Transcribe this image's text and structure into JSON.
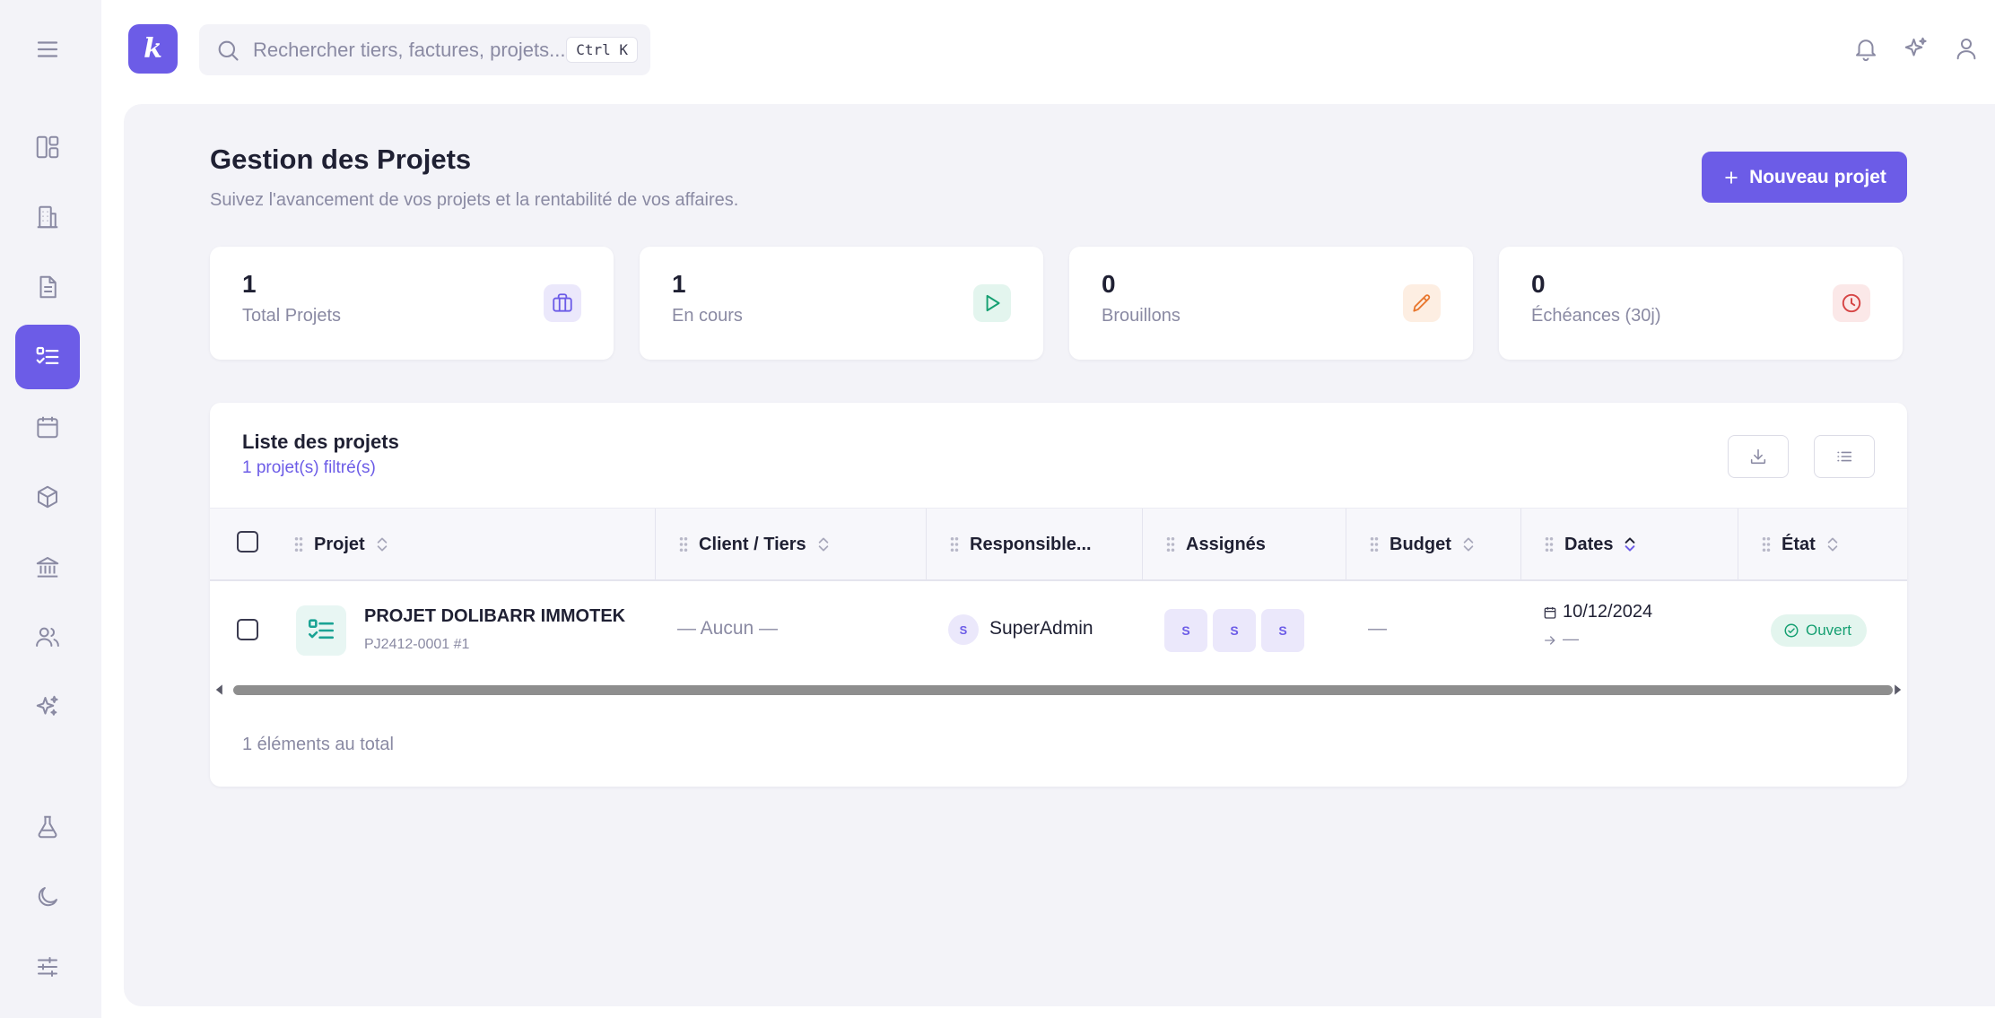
{
  "app": {
    "logo_letter": "k",
    "accent": "#6c5ce7"
  },
  "search": {
    "placeholder": "Rechercher tiers, factures, projets...",
    "shortcut": "Ctrl K"
  },
  "sidebar": {
    "items": [
      {
        "icon": "dashboard-icon",
        "active": false
      },
      {
        "icon": "building-icon",
        "active": false
      },
      {
        "icon": "document-icon",
        "active": false
      },
      {
        "icon": "checklist-icon",
        "active": true
      },
      {
        "icon": "calendar-icon",
        "active": false
      },
      {
        "icon": "box-icon",
        "active": false
      },
      {
        "icon": "bank-icon",
        "active": false
      },
      {
        "icon": "users-icon",
        "active": false
      },
      {
        "icon": "sparkles-icon",
        "active": false
      },
      {
        "icon": "flask-icon",
        "active": false
      },
      {
        "icon": "moon-icon",
        "active": false
      },
      {
        "icon": "sliders-icon",
        "active": false
      }
    ]
  },
  "topbar": {
    "icons": [
      "bell-icon",
      "sparkles-icon",
      "user-icon"
    ]
  },
  "page": {
    "title": "Gestion des Projets",
    "subtitle": "Suivez l'avancement de vos projets et la rentabilité de vos affaires.",
    "new_button": "Nouveau projet"
  },
  "stats": [
    {
      "value": "1",
      "label": "Total Projets",
      "icon": "briefcase-icon",
      "color": "#6c5ce7",
      "bg": "#ebe8fb"
    },
    {
      "value": "1",
      "label": "En cours",
      "icon": "play-icon",
      "color": "#16a072",
      "bg": "#e3f5ee"
    },
    {
      "value": "0",
      "label": "Brouillons",
      "icon": "pencil-icon",
      "color": "#e8772e",
      "bg": "#fdeee2"
    },
    {
      "value": "0",
      "label": "Échéances (30j)",
      "icon": "clock-icon",
      "color": "#d64545",
      "bg": "#fbe8e8"
    }
  ],
  "table": {
    "title": "Liste des projets",
    "filter_count": "1 projet(s) filtré(s)",
    "columns": [
      "Projet",
      "Client / Tiers",
      "Responsible...",
      "Assignés",
      "Budget",
      "Dates",
      "État"
    ],
    "rows": [
      {
        "name": "PROJET DOLIBARR IMMOTEK",
        "ref": "PJ2412-0001 #1",
        "client": "— Aucun —",
        "responsible_initial": "S",
        "responsible": "SuperAdmin",
        "assignees": [
          "S",
          "S",
          "S"
        ],
        "budget": "—",
        "date_start": "10/12/2024",
        "date_end": "—",
        "status": "Ouvert"
      }
    ],
    "total": "1 éléments au total"
  }
}
